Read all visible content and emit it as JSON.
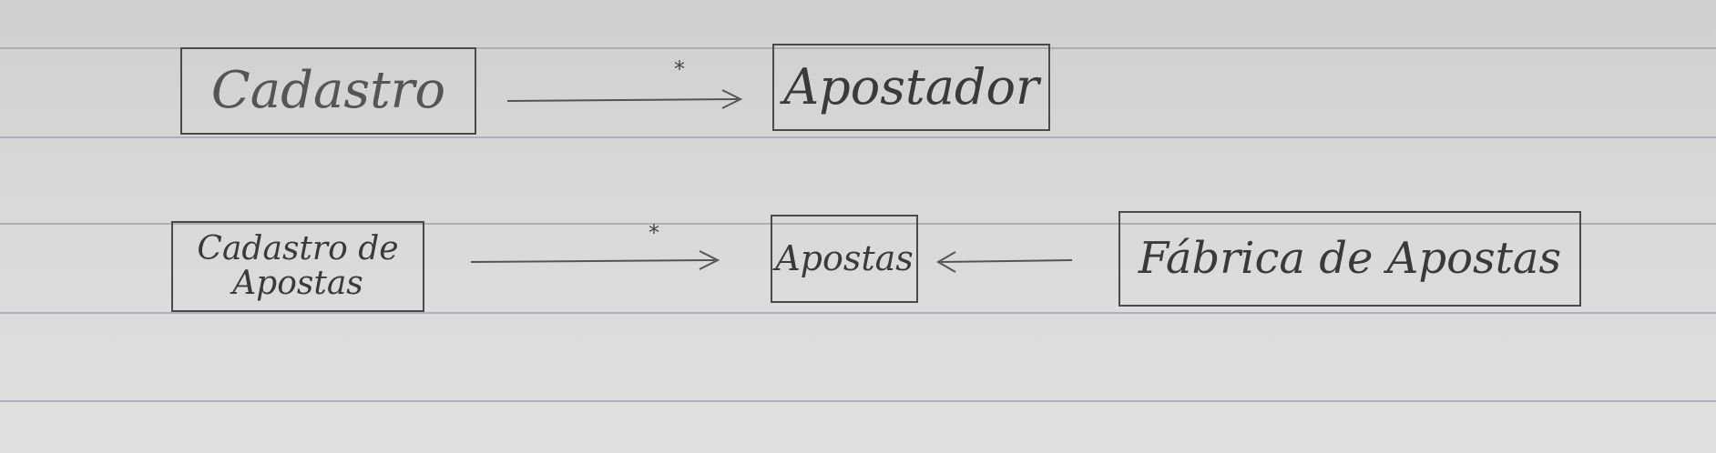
{
  "diagram": {
    "row1": {
      "source": "Cadastro",
      "multiplicity": "*",
      "target": "Apostador"
    },
    "row2": {
      "source": "Cadastro de Apostas",
      "multiplicity": "*",
      "target": "Apostas",
      "factory": "Fábrica de Apostas"
    }
  }
}
